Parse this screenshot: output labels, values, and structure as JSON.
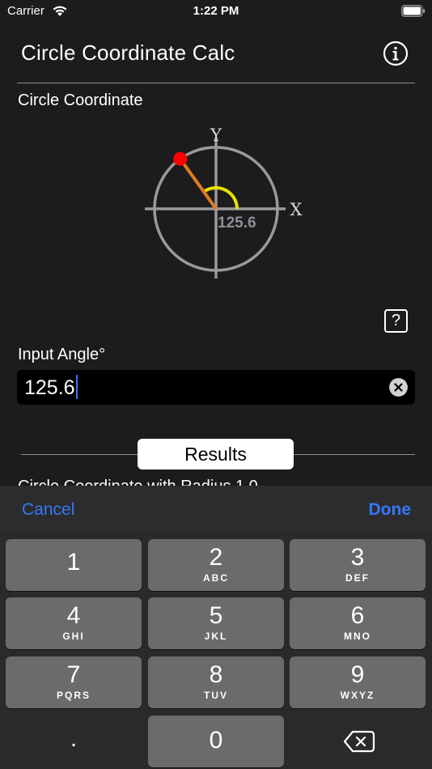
{
  "status_bar": {
    "carrier": "Carrier",
    "time": "1:22 PM"
  },
  "header": {
    "title": "Circle Coordinate Calc"
  },
  "section": {
    "label": "Circle Coordinate"
  },
  "diagram": {
    "y_axis": "Y",
    "x_axis": "X",
    "angle_label": "125.6",
    "angle_deg": 125.6,
    "point_color": "#ff0000",
    "radius_color": "#e07b1a",
    "arc_color": "#e8e000"
  },
  "help": {
    "label": "?"
  },
  "input": {
    "label": "Input Angle°",
    "value": "125.6"
  },
  "results": {
    "label": "Results",
    "next_line": "Circle Coordinate with Radius 1.0"
  },
  "accessory": {
    "cancel": "Cancel",
    "done": "Done"
  },
  "keypad": {
    "keys": [
      {
        "num": "1",
        "letters": ""
      },
      {
        "num": "2",
        "letters": "ABC"
      },
      {
        "num": "3",
        "letters": "DEF"
      },
      {
        "num": "4",
        "letters": "GHI"
      },
      {
        "num": "5",
        "letters": "JKL"
      },
      {
        "num": "6",
        "letters": "MNO"
      },
      {
        "num": "7",
        "letters": "PQRS"
      },
      {
        "num": "8",
        "letters": "TUV"
      },
      {
        "num": "9",
        "letters": "WXYZ"
      }
    ],
    "decimal": ".",
    "zero": "0"
  },
  "colors": {
    "accent": "#3478f6",
    "background": "#1c1c1e"
  }
}
